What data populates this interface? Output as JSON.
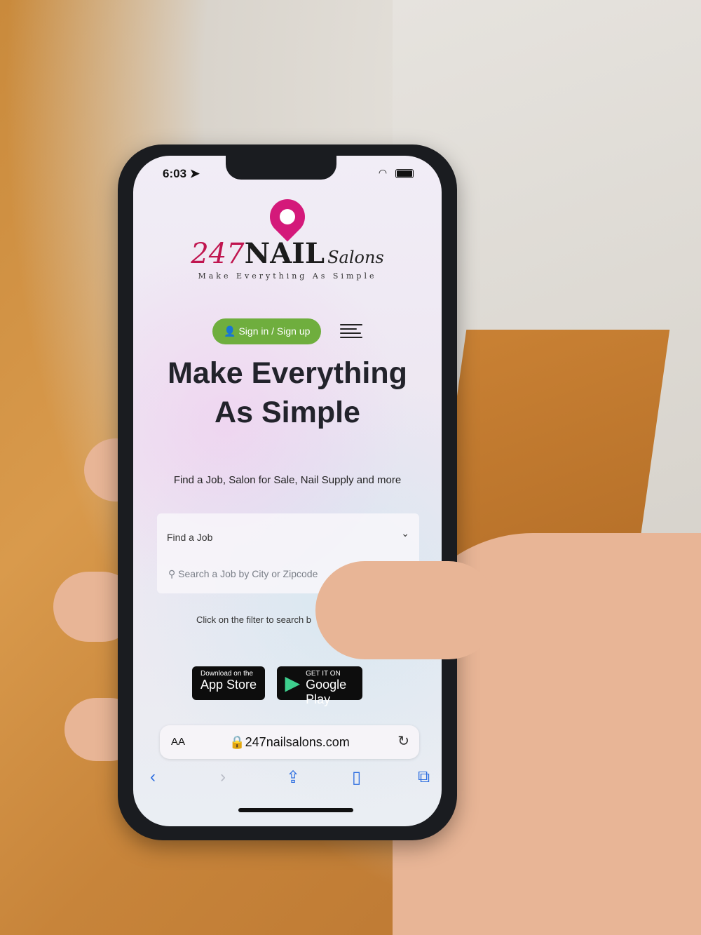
{
  "status": {
    "time": "6:03"
  },
  "logo": {
    "num": "247",
    "nail": "NAIL",
    "salons": "Salons",
    "tagline": "Make Everything As Simple"
  },
  "header": {
    "signin_label": "Sign in / Sign up"
  },
  "hero": {
    "headline": "Make Everything As Simple",
    "subline": "Find a Job, Salon for Sale, Nail Supply and more"
  },
  "search": {
    "category": "Find a Job",
    "placeholder": "Search a Job by City or Zipcode",
    "hint": "Click on the filter to search b"
  },
  "stores": {
    "apple_small": "Download on the",
    "apple_big": "App Store",
    "google_small": "GET IT ON",
    "google_big": "Google Play"
  },
  "browser": {
    "aa": "AA",
    "url": "247nailsalons.com"
  },
  "icons": [
    "location-arrow-icon",
    "wifi-icon",
    "battery-icon",
    "user-icon",
    "menu-icon",
    "chevron-down-icon",
    "search-icon",
    "apple-icon",
    "google-play-icon",
    "lock-icon",
    "reload-icon",
    "back-icon",
    "forward-icon",
    "share-icon",
    "bookmarks-icon",
    "tabs-icon"
  ],
  "colors": {
    "brand_pink": "#d4197a",
    "signin_green": "#6fae3e",
    "safari_blue": "#2f6fe0"
  }
}
